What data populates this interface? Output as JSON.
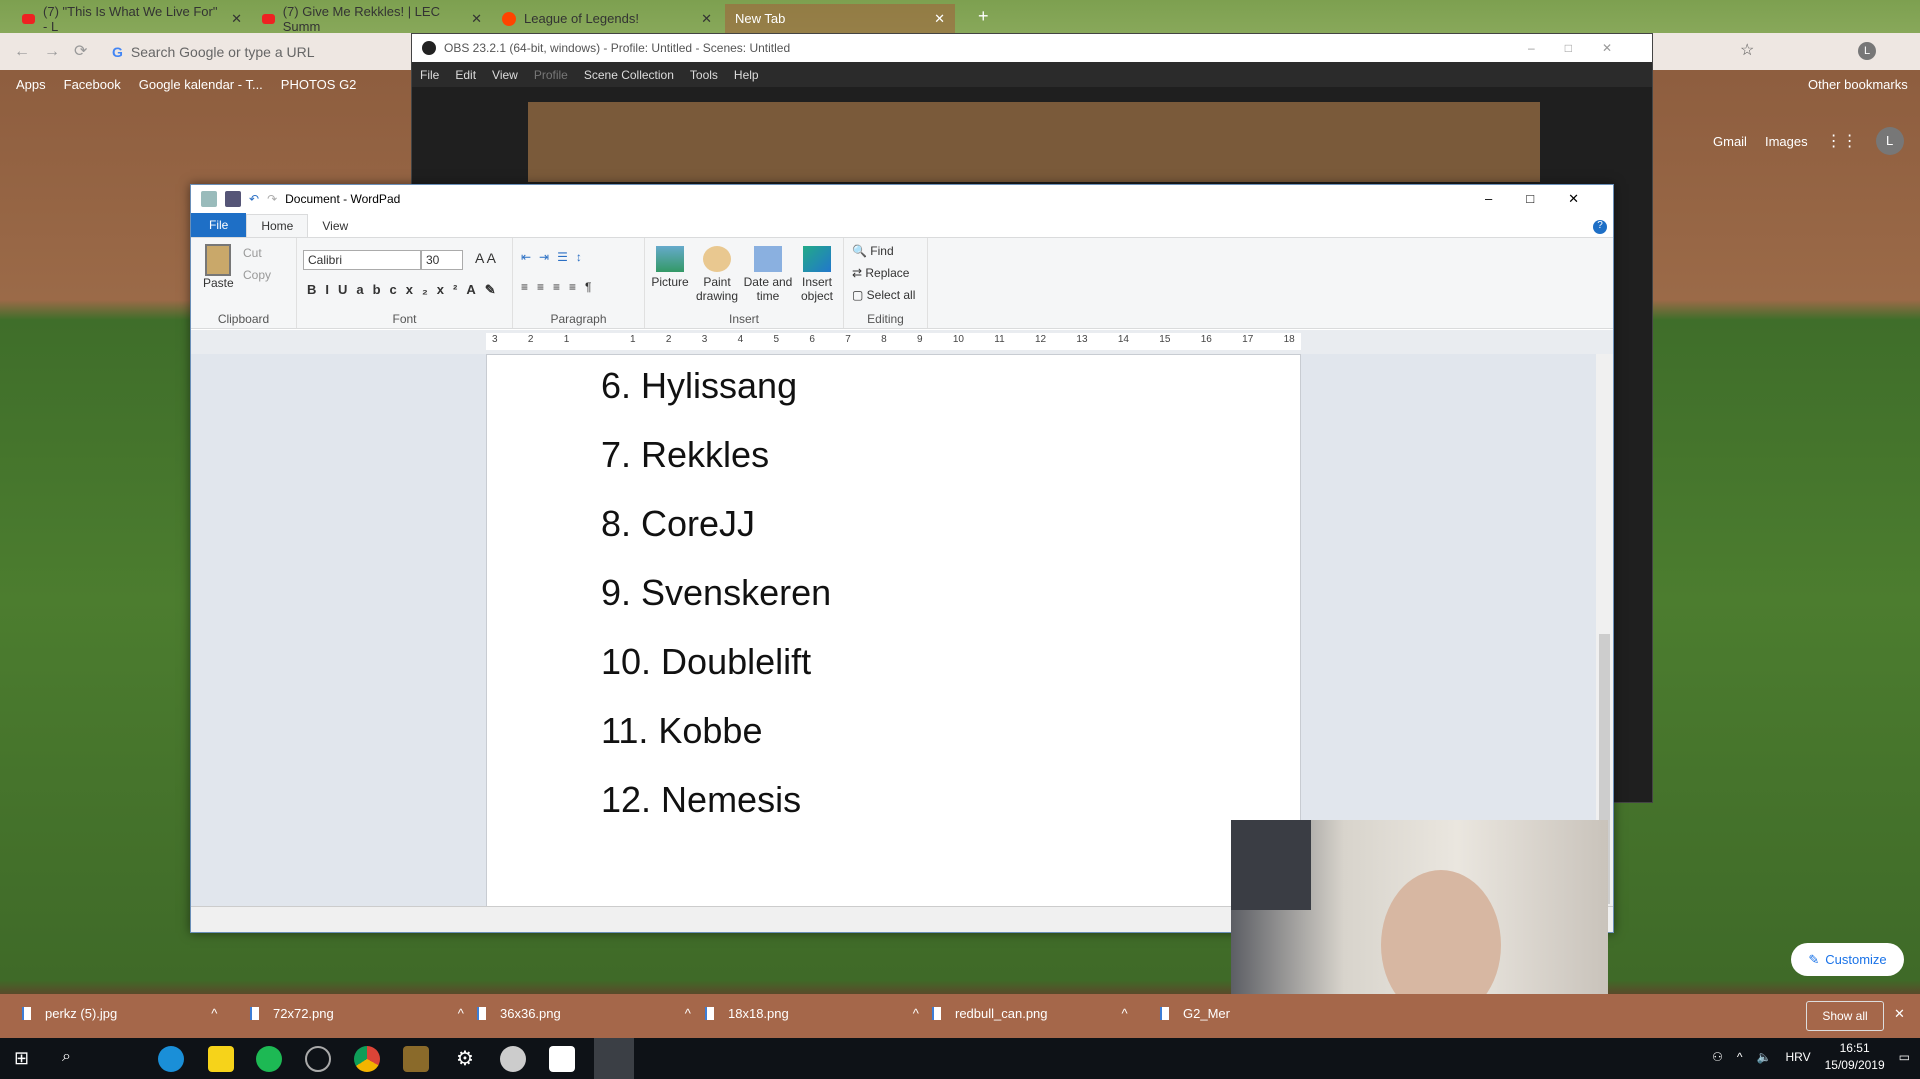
{
  "chrome": {
    "tabs": [
      {
        "label": "(7) \"This Is What We Live For\" - L",
        "icon": "youtube-icon"
      },
      {
        "label": "(7) Give Me Rekkles! | LEC Summ",
        "icon": "youtube-icon"
      },
      {
        "label": "League of Legends!",
        "icon": "reddit-icon"
      },
      {
        "label": "New Tab",
        "icon": ""
      }
    ],
    "omnibox_placeholder": "Search Google or type a URL",
    "bookmarks": [
      "Apps",
      "Facebook",
      "Google kalendar - T...",
      "PHOTOS G2"
    ],
    "other_bookmarks": "Other bookmarks",
    "ntp": {
      "gmail": "Gmail",
      "images": "Images",
      "avatar": "L",
      "customize": "Customize"
    }
  },
  "obs": {
    "title": "OBS 23.2.1 (64-bit, windows) - Profile: Untitled - Scenes: Untitled",
    "menu": [
      "File",
      "Edit",
      "View",
      "Profile",
      "Scene Collection",
      "Tools",
      "Help"
    ]
  },
  "wordpad": {
    "title": "Document - WordPad",
    "tabs": [
      "File",
      "Home",
      "View"
    ],
    "ribbon": {
      "clipboard": {
        "label": "Clipboard",
        "paste": "Paste",
        "cut": "Cut",
        "copy": "Copy"
      },
      "font": {
        "label": "Font",
        "family": "Calibri",
        "size": "30"
      },
      "paragraph": {
        "label": "Paragraph"
      },
      "insert": {
        "label": "Insert",
        "picture": "Picture",
        "paint": "Paint drawing",
        "datetime": "Date and time",
        "object": "Insert object"
      },
      "editing": {
        "label": "Editing",
        "find": "Find",
        "replace": "Replace",
        "select_all": "Select all"
      }
    },
    "ruler": [
      "3",
      "2",
      "1",
      "",
      "1",
      "2",
      "3",
      "4",
      "5",
      "6",
      "7",
      "8",
      "9",
      "10",
      "11",
      "12",
      "13",
      "14",
      "15",
      "16",
      "17",
      "18"
    ],
    "lines": [
      "6. Hylissang",
      "7. Rekkles",
      "8. CoreJJ",
      "9. Svenskeren",
      "10. Doublelift",
      "11. Kobbe",
      "12. Nemesis"
    ]
  },
  "downloads": {
    "items": [
      "perkz (5).jpg",
      "72x72.png",
      "36x36.png",
      "18x18.png",
      "redbull_can.png",
      "G2_Mer"
    ],
    "show_all": "Show all"
  },
  "taskbar": {
    "lang": "HRV",
    "time": "16:51",
    "date": "15/09/2019"
  }
}
